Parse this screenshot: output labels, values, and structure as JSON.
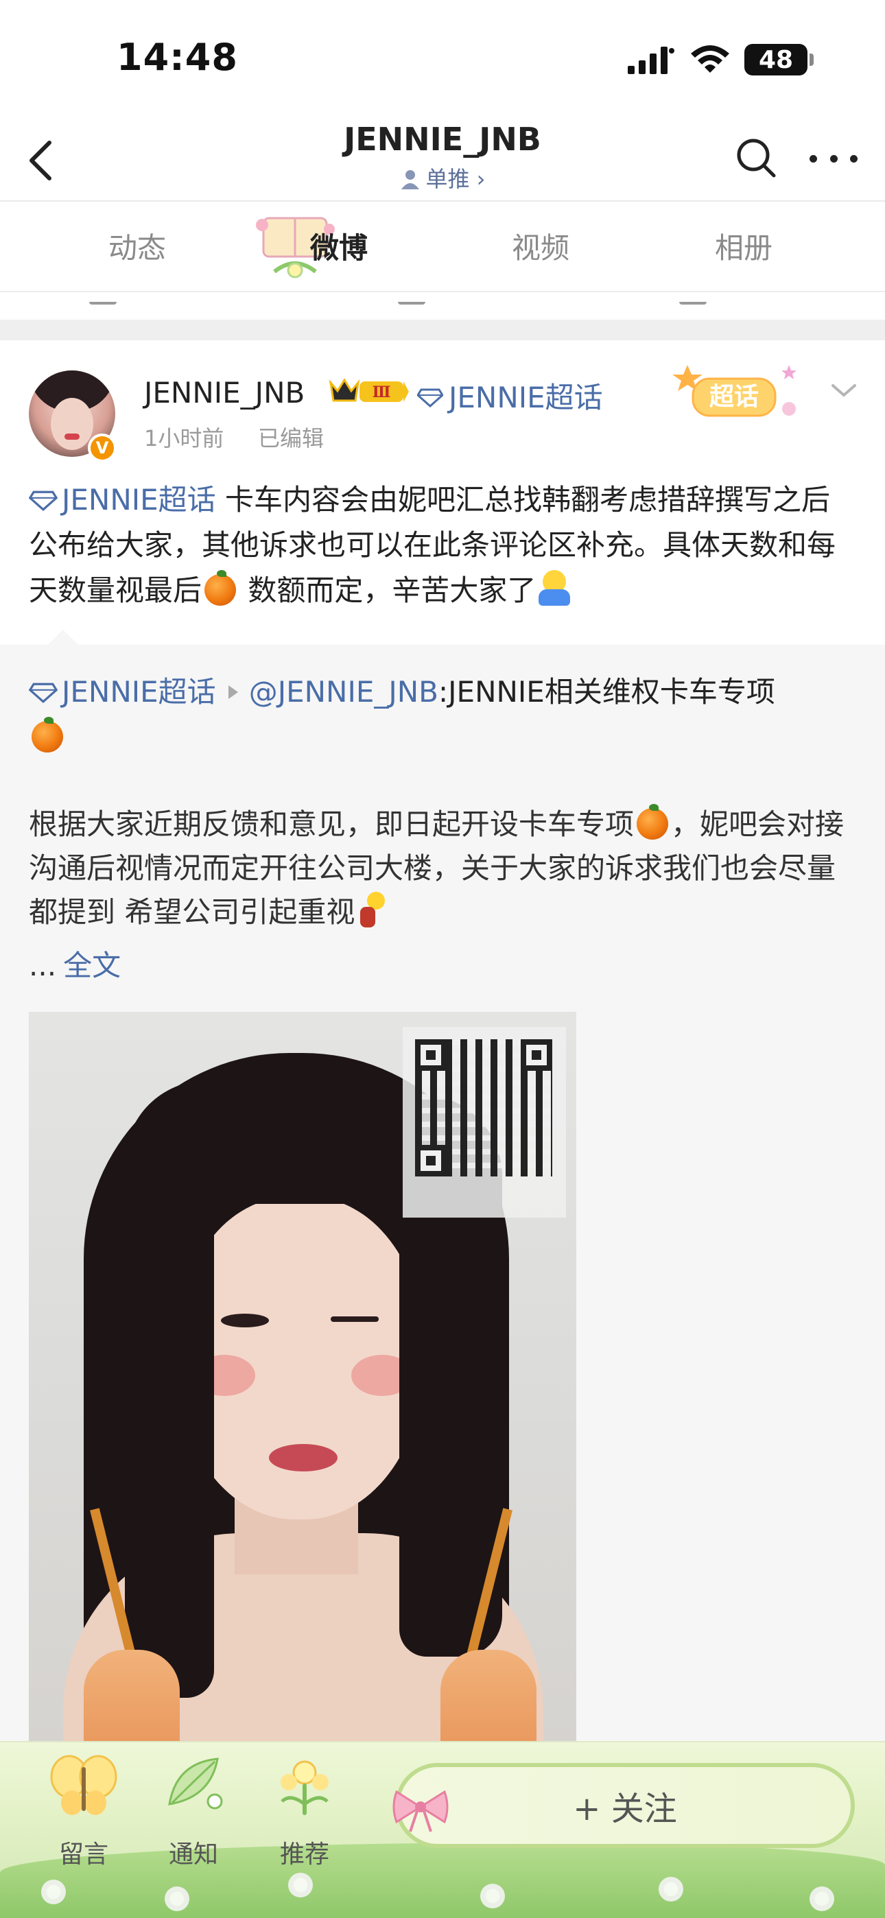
{
  "status_bar": {
    "time": "14:48",
    "battery": "48"
  },
  "nav": {
    "title": "JENNIE_JNB",
    "subtitle": "单推 ›"
  },
  "tabs": [
    {
      "label": "动态"
    },
    {
      "label": "微博"
    },
    {
      "label": "视频"
    },
    {
      "label": "相册"
    }
  ],
  "post": {
    "author": "JENNIE_JNB",
    "level_badge": "Ⅲ",
    "topic": "JENNIE超话",
    "badge_label": "超话",
    "time": "1小时前",
    "edited": "已编辑",
    "text_topic": "JENNIE超话",
    "text_part1": " 卡车内容会由妮吧汇总找韩翻考虑措辞撰写之后公布给大家，其他诉求也可以在此条评论区补充。具体天数和每天数量视最后",
    "text_part2": " 数额而定，辛苦大家了"
  },
  "repost": {
    "topic": "JENNIE超话",
    "mention": "@JENNIE_JNB",
    "title": ":JENNIE相关维权卡车专项",
    "body_part1": "根据大家近期反馈和意见，即日起开设卡车专项",
    "body_part2": "，妮吧会对接沟通后视情况而定开往公司大楼，关于大家的诉求我们也会尽量都提到 希望公司引起重视",
    "ellipsis": "...",
    "more": "全文"
  },
  "bottom_bar": {
    "comment": "留言",
    "notify": "通知",
    "recommend": "推荐",
    "follow": "+ 关注"
  },
  "colors": {
    "link": "#4a6da8",
    "orange_badge": "#f39400",
    "bottom_green": "#cfe7b2"
  }
}
